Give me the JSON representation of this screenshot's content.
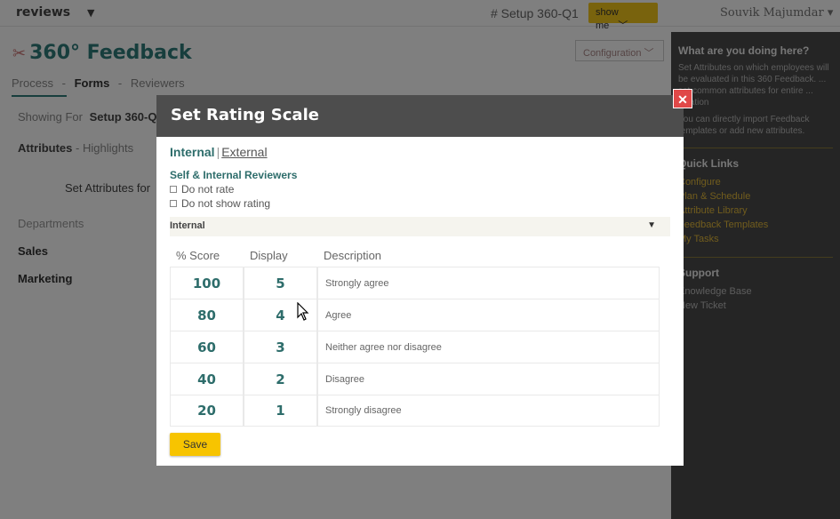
{
  "topbar": {
    "app_name": "reviews",
    "app_caret": "▼",
    "setup": "# Setup 360-Q1",
    "show_me": "show me",
    "user": "Souvik Majumdar ▾"
  },
  "page": {
    "title": "360° Feedback",
    "config_button": "Configuration",
    "subnav": [
      "Process",
      "Forms",
      "Reviewers"
    ],
    "subnav_sep": "-",
    "showing_label": "Showing For",
    "showing_value": "Setup 360-Q",
    "tabs": [
      "Attributes",
      "Highlights"
    ],
    "set_attributes": "Set Attributes for",
    "departments_header": "Departments",
    "departments": [
      "Sales",
      "Marketing"
    ]
  },
  "sidebar": {
    "heading": "What are you doing here?",
    "para1": "Set Attributes on which employees will be evaluated in this 360 Feedback. ... set common attributes for entire ... nization",
    "para2": "You can directly import Feedback templates or add new attributes.",
    "quick_links_heading": "Quick Links",
    "quick_links": [
      "Configure",
      "Plan & Schedule",
      "Attribute Library",
      "Feedback Templates",
      "My Tasks"
    ],
    "support_heading": "Support",
    "support_links": [
      "Knowledge Base",
      "New Ticket"
    ]
  },
  "modal": {
    "title": "Set Rating Scale",
    "close": "✕",
    "tab_internal": "Internal",
    "tab_sep": "|",
    "tab_external": "External",
    "reviewers_label": "Self & Internal Reviewers",
    "checkbox1": "Do not rate",
    "checkbox2": "Do not show rating",
    "select_value": "Internal",
    "select_arrow": "▼",
    "columns": [
      "% Score",
      "Display",
      "Description"
    ],
    "rows": [
      {
        "score": "100",
        "display": "5",
        "description": "Strongly agree"
      },
      {
        "score": "80",
        "display": "4",
        "description": "Agree"
      },
      {
        "score": "60",
        "display": "3",
        "description": "Neither agree nor disagree"
      },
      {
        "score": "40",
        "display": "2",
        "description": "Disagree"
      },
      {
        "score": "20",
        "display": "1",
        "description": "Strongly disagree"
      }
    ],
    "save": "Save"
  }
}
